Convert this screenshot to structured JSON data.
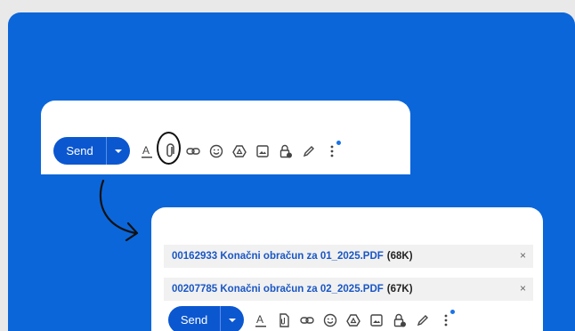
{
  "compose_top": {
    "send_label": "Send",
    "icons": [
      "formatting-icon",
      "attach-icon",
      "link-icon",
      "emoji-icon",
      "drive-icon",
      "photo-icon",
      "confidential-icon",
      "signature-icon",
      "more-options-icon"
    ]
  },
  "compose_bottom": {
    "send_label": "Send",
    "attachments": [
      {
        "name": "00162933 Konačni obračun za 01_2025.PDF",
        "size": "(68K)"
      },
      {
        "name": "00207785 Konačni obračun za 02_2025.PDF",
        "size": "(67K)"
      }
    ],
    "close_glyph": "×"
  },
  "colors": {
    "background": "#0b66d9",
    "send_button": "#0b57d0",
    "attachment_link": "#1a56c4"
  }
}
